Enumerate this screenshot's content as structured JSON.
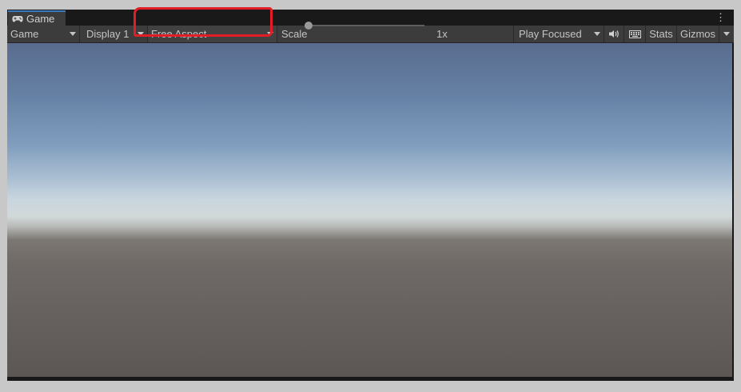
{
  "tab": {
    "title": "Game",
    "icon": "gamepad-icon"
  },
  "toolbar": {
    "mode_dropdown": "Game",
    "display_dropdown": "Display 1",
    "aspect_dropdown": "Free Aspect",
    "scale_label": "Scale",
    "scale_value": "1x",
    "scale_level": 0.0,
    "play_mode_dropdown": "Play Focused",
    "audio_icon": "speaker-icon",
    "keyboard_icon": "keyboard-icon",
    "stats_button": "Stats",
    "gizmos_button": "Gizmos"
  },
  "colors": {
    "highlight": "#e11d25",
    "tab_accent": "#3a79bb"
  }
}
